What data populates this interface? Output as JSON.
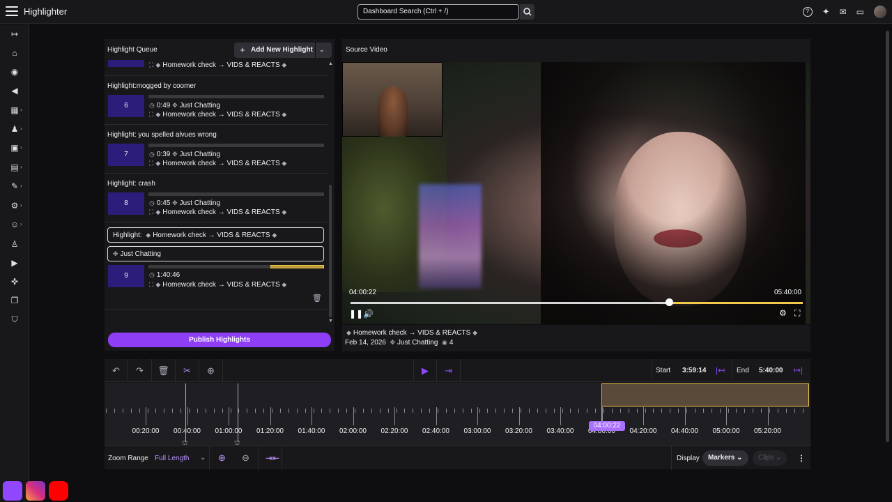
{
  "app": {
    "title": "Highlighter"
  },
  "search": {
    "placeholder": "Dashboard Search (Ctrl + /)"
  },
  "queue": {
    "title": "Highlight Queue",
    "add_label": "Add New Highlight",
    "top_partial_tags": "Homework check → VIDS & REACTS",
    "items": [
      {
        "title": "Highlight:mogged by coomer",
        "num": "6",
        "duration": "0:49",
        "category": "Just Chatting",
        "tags": "Homework check → VIDS & REACTS"
      },
      {
        "title": "Highlight: you spelled alvues wrong",
        "num": "7",
        "duration": "0:39",
        "category": "Just Chatting",
        "tags": "Homework check → VIDS & REACTS"
      },
      {
        "title": "Highlight: crash",
        "num": "8",
        "duration": "0:45",
        "category": "Just Chatting",
        "tags": "Homework check → VIDS & REACTS"
      }
    ],
    "editing": {
      "title_prefix": "Highlight:",
      "title_value": "Homework check → VIDS & REACTS",
      "category": "Just Chatting",
      "num": "9",
      "duration": "1:40:46",
      "tags": "Homework check → VIDS & REACTS"
    },
    "publish_label": "Publish Highlights"
  },
  "video": {
    "title": "Source Video",
    "current": "04:00:22",
    "end": "05:40:00",
    "progress_fraction": 0.7,
    "info_title": "Homework check → VIDS & REACTS",
    "info_date": "Feb 14, 2026",
    "info_category": "Just Chatting",
    "info_views": "4"
  },
  "timeline": {
    "start_label": "Start",
    "start_value": "3:59:14",
    "end_label": "End",
    "end_value": "5:40:00",
    "ticks": [
      "00:20:00",
      "00:40:00",
      "01:00:00",
      "01:20:00",
      "01:40:00",
      "02:00:00",
      "02:20:00",
      "02:40:00",
      "03:00:00",
      "03:20:00",
      "03:40:00",
      "04:00:00",
      "04:20:00",
      "04:40:00",
      "05:00:00",
      "05:20:00"
    ],
    "playhead": "04:00:22",
    "zoom_label": "Zoom Range",
    "zoom_value": "Full Length",
    "display_label": "Display",
    "markers_label": "Markers",
    "clips_label": "Clips"
  },
  "colors": {
    "accent": "#9147ff",
    "selection": "#f3c94b"
  }
}
